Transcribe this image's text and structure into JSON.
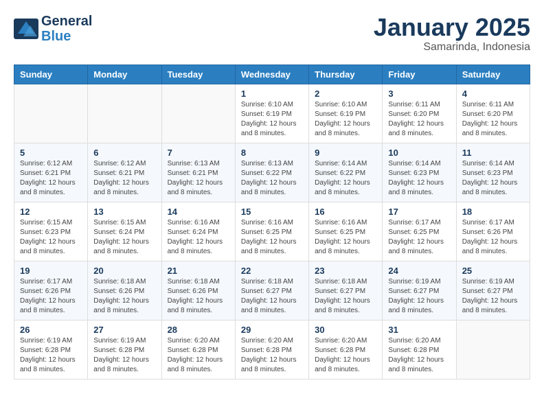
{
  "header": {
    "logo_line1": "General",
    "logo_line2": "Blue",
    "month_title": "January 2025",
    "location": "Samarinda, Indonesia"
  },
  "days_of_week": [
    "Sunday",
    "Monday",
    "Tuesday",
    "Wednesday",
    "Thursday",
    "Friday",
    "Saturday"
  ],
  "weeks": [
    [
      {
        "day": "",
        "info": ""
      },
      {
        "day": "",
        "info": ""
      },
      {
        "day": "",
        "info": ""
      },
      {
        "day": "1",
        "info": "Sunrise: 6:10 AM\nSunset: 6:19 PM\nDaylight: 12 hours and 8 minutes."
      },
      {
        "day": "2",
        "info": "Sunrise: 6:10 AM\nSunset: 6:19 PM\nDaylight: 12 hours and 8 minutes."
      },
      {
        "day": "3",
        "info": "Sunrise: 6:11 AM\nSunset: 6:20 PM\nDaylight: 12 hours and 8 minutes."
      },
      {
        "day": "4",
        "info": "Sunrise: 6:11 AM\nSunset: 6:20 PM\nDaylight: 12 hours and 8 minutes."
      }
    ],
    [
      {
        "day": "5",
        "info": "Sunrise: 6:12 AM\nSunset: 6:21 PM\nDaylight: 12 hours and 8 minutes."
      },
      {
        "day": "6",
        "info": "Sunrise: 6:12 AM\nSunset: 6:21 PM\nDaylight: 12 hours and 8 minutes."
      },
      {
        "day": "7",
        "info": "Sunrise: 6:13 AM\nSunset: 6:21 PM\nDaylight: 12 hours and 8 minutes."
      },
      {
        "day": "8",
        "info": "Sunrise: 6:13 AM\nSunset: 6:22 PM\nDaylight: 12 hours and 8 minutes."
      },
      {
        "day": "9",
        "info": "Sunrise: 6:14 AM\nSunset: 6:22 PM\nDaylight: 12 hours and 8 minutes."
      },
      {
        "day": "10",
        "info": "Sunrise: 6:14 AM\nSunset: 6:23 PM\nDaylight: 12 hours and 8 minutes."
      },
      {
        "day": "11",
        "info": "Sunrise: 6:14 AM\nSunset: 6:23 PM\nDaylight: 12 hours and 8 minutes."
      }
    ],
    [
      {
        "day": "12",
        "info": "Sunrise: 6:15 AM\nSunset: 6:23 PM\nDaylight: 12 hours and 8 minutes."
      },
      {
        "day": "13",
        "info": "Sunrise: 6:15 AM\nSunset: 6:24 PM\nDaylight: 12 hours and 8 minutes."
      },
      {
        "day": "14",
        "info": "Sunrise: 6:16 AM\nSunset: 6:24 PM\nDaylight: 12 hours and 8 minutes."
      },
      {
        "day": "15",
        "info": "Sunrise: 6:16 AM\nSunset: 6:25 PM\nDaylight: 12 hours and 8 minutes."
      },
      {
        "day": "16",
        "info": "Sunrise: 6:16 AM\nSunset: 6:25 PM\nDaylight: 12 hours and 8 minutes."
      },
      {
        "day": "17",
        "info": "Sunrise: 6:17 AM\nSunset: 6:25 PM\nDaylight: 12 hours and 8 minutes."
      },
      {
        "day": "18",
        "info": "Sunrise: 6:17 AM\nSunset: 6:26 PM\nDaylight: 12 hours and 8 minutes."
      }
    ],
    [
      {
        "day": "19",
        "info": "Sunrise: 6:17 AM\nSunset: 6:26 PM\nDaylight: 12 hours and 8 minutes."
      },
      {
        "day": "20",
        "info": "Sunrise: 6:18 AM\nSunset: 6:26 PM\nDaylight: 12 hours and 8 minutes."
      },
      {
        "day": "21",
        "info": "Sunrise: 6:18 AM\nSunset: 6:26 PM\nDaylight: 12 hours and 8 minutes."
      },
      {
        "day": "22",
        "info": "Sunrise: 6:18 AM\nSunset: 6:27 PM\nDaylight: 12 hours and 8 minutes."
      },
      {
        "day": "23",
        "info": "Sunrise: 6:18 AM\nSunset: 6:27 PM\nDaylight: 12 hours and 8 minutes."
      },
      {
        "day": "24",
        "info": "Sunrise: 6:19 AM\nSunset: 6:27 PM\nDaylight: 12 hours and 8 minutes."
      },
      {
        "day": "25",
        "info": "Sunrise: 6:19 AM\nSunset: 6:27 PM\nDaylight: 12 hours and 8 minutes."
      }
    ],
    [
      {
        "day": "26",
        "info": "Sunrise: 6:19 AM\nSunset: 6:28 PM\nDaylight: 12 hours and 8 minutes."
      },
      {
        "day": "27",
        "info": "Sunrise: 6:19 AM\nSunset: 6:28 PM\nDaylight: 12 hours and 8 minutes."
      },
      {
        "day": "28",
        "info": "Sunrise: 6:20 AM\nSunset: 6:28 PM\nDaylight: 12 hours and 8 minutes."
      },
      {
        "day": "29",
        "info": "Sunrise: 6:20 AM\nSunset: 6:28 PM\nDaylight: 12 hours and 8 minutes."
      },
      {
        "day": "30",
        "info": "Sunrise: 6:20 AM\nSunset: 6:28 PM\nDaylight: 12 hours and 8 minutes."
      },
      {
        "day": "31",
        "info": "Sunrise: 6:20 AM\nSunset: 6:28 PM\nDaylight: 12 hours and 8 minutes."
      },
      {
        "day": "",
        "info": ""
      }
    ]
  ]
}
